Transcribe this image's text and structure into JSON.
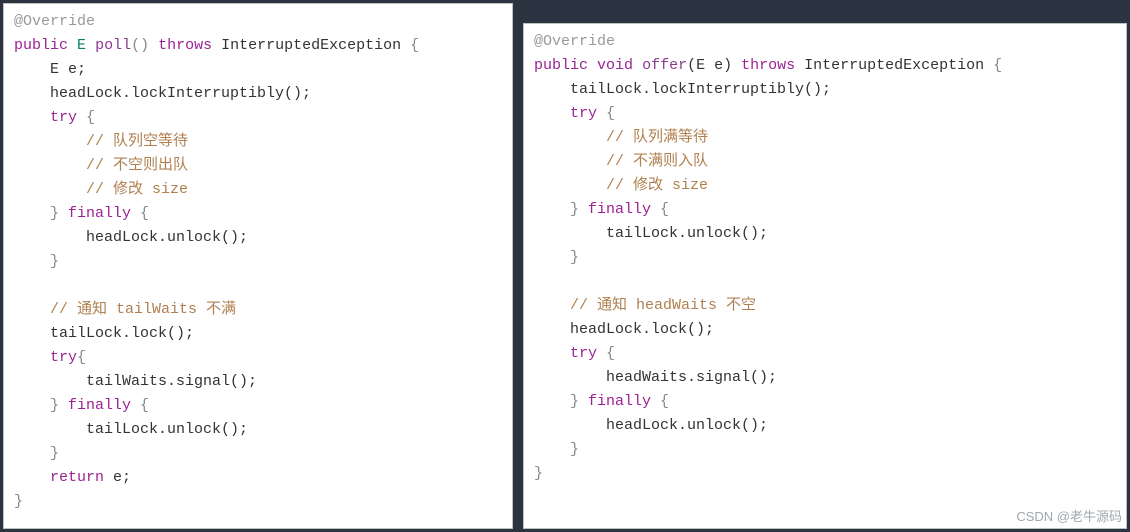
{
  "left": {
    "l1": "@Override",
    "l2_kw1": "public",
    "l2_type": "E",
    "l2_method": "poll",
    "l2_paren": "()",
    "l2_kw2": "throws",
    "l2_exc": "InterruptedException",
    "l2_brace": " {",
    "l3": "    E e;",
    "l4": "    headLock.lockInterruptibly();",
    "l5_kw": "try",
    "l5_brace": " {",
    "l6": "        // 队列空等待",
    "l7": "        // 不空则出队",
    "l8": "        // 修改 size",
    "l9a": "    }",
    "l9_kw": "finally",
    "l9_brace": " {",
    "l10": "        headLock.unlock();",
    "l11": "    }",
    "l13": "    // 通知 tailWaits 不满",
    "l14": "    tailLock.lock();",
    "l15_kw": "try",
    "l15_brace": "{",
    "l16": "        tailWaits.signal();",
    "l17a": "    }",
    "l17_kw": "finally",
    "l17_brace": " {",
    "l18": "        tailLock.unlock();",
    "l19": "    }",
    "l20_kw": "return",
    "l20_rest": " e;",
    "l21": "}"
  },
  "right": {
    "l1": "@Override",
    "l2_kw1": "public",
    "l2_type": "void",
    "l2_method": "offer",
    "l2_paren": "(E e)",
    "l2_kw2": "throws",
    "l2_exc": "InterruptedException",
    "l2_brace": " {",
    "l3": "    tailLock.lockInterruptibly();",
    "l4_kw": "try",
    "l4_brace": " {",
    "l5": "        // 队列满等待",
    "l6": "        // 不满则入队",
    "l7": "        // 修改 size",
    "l8a": "    }",
    "l8_kw": "finally",
    "l8_brace": " {",
    "l9": "        tailLock.unlock();",
    "l10": "    }",
    "l12": "    // 通知 headWaits 不空",
    "l13": "    headLock.lock();",
    "l14_kw": "try",
    "l14_brace": " {",
    "l15": "        headWaits.signal();",
    "l16a": "    }",
    "l16_kw": "finally",
    "l16_brace": " {",
    "l17": "        headLock.unlock();",
    "l18": "    }",
    "l19": "}"
  },
  "watermark": "CSDN @老牛源码"
}
